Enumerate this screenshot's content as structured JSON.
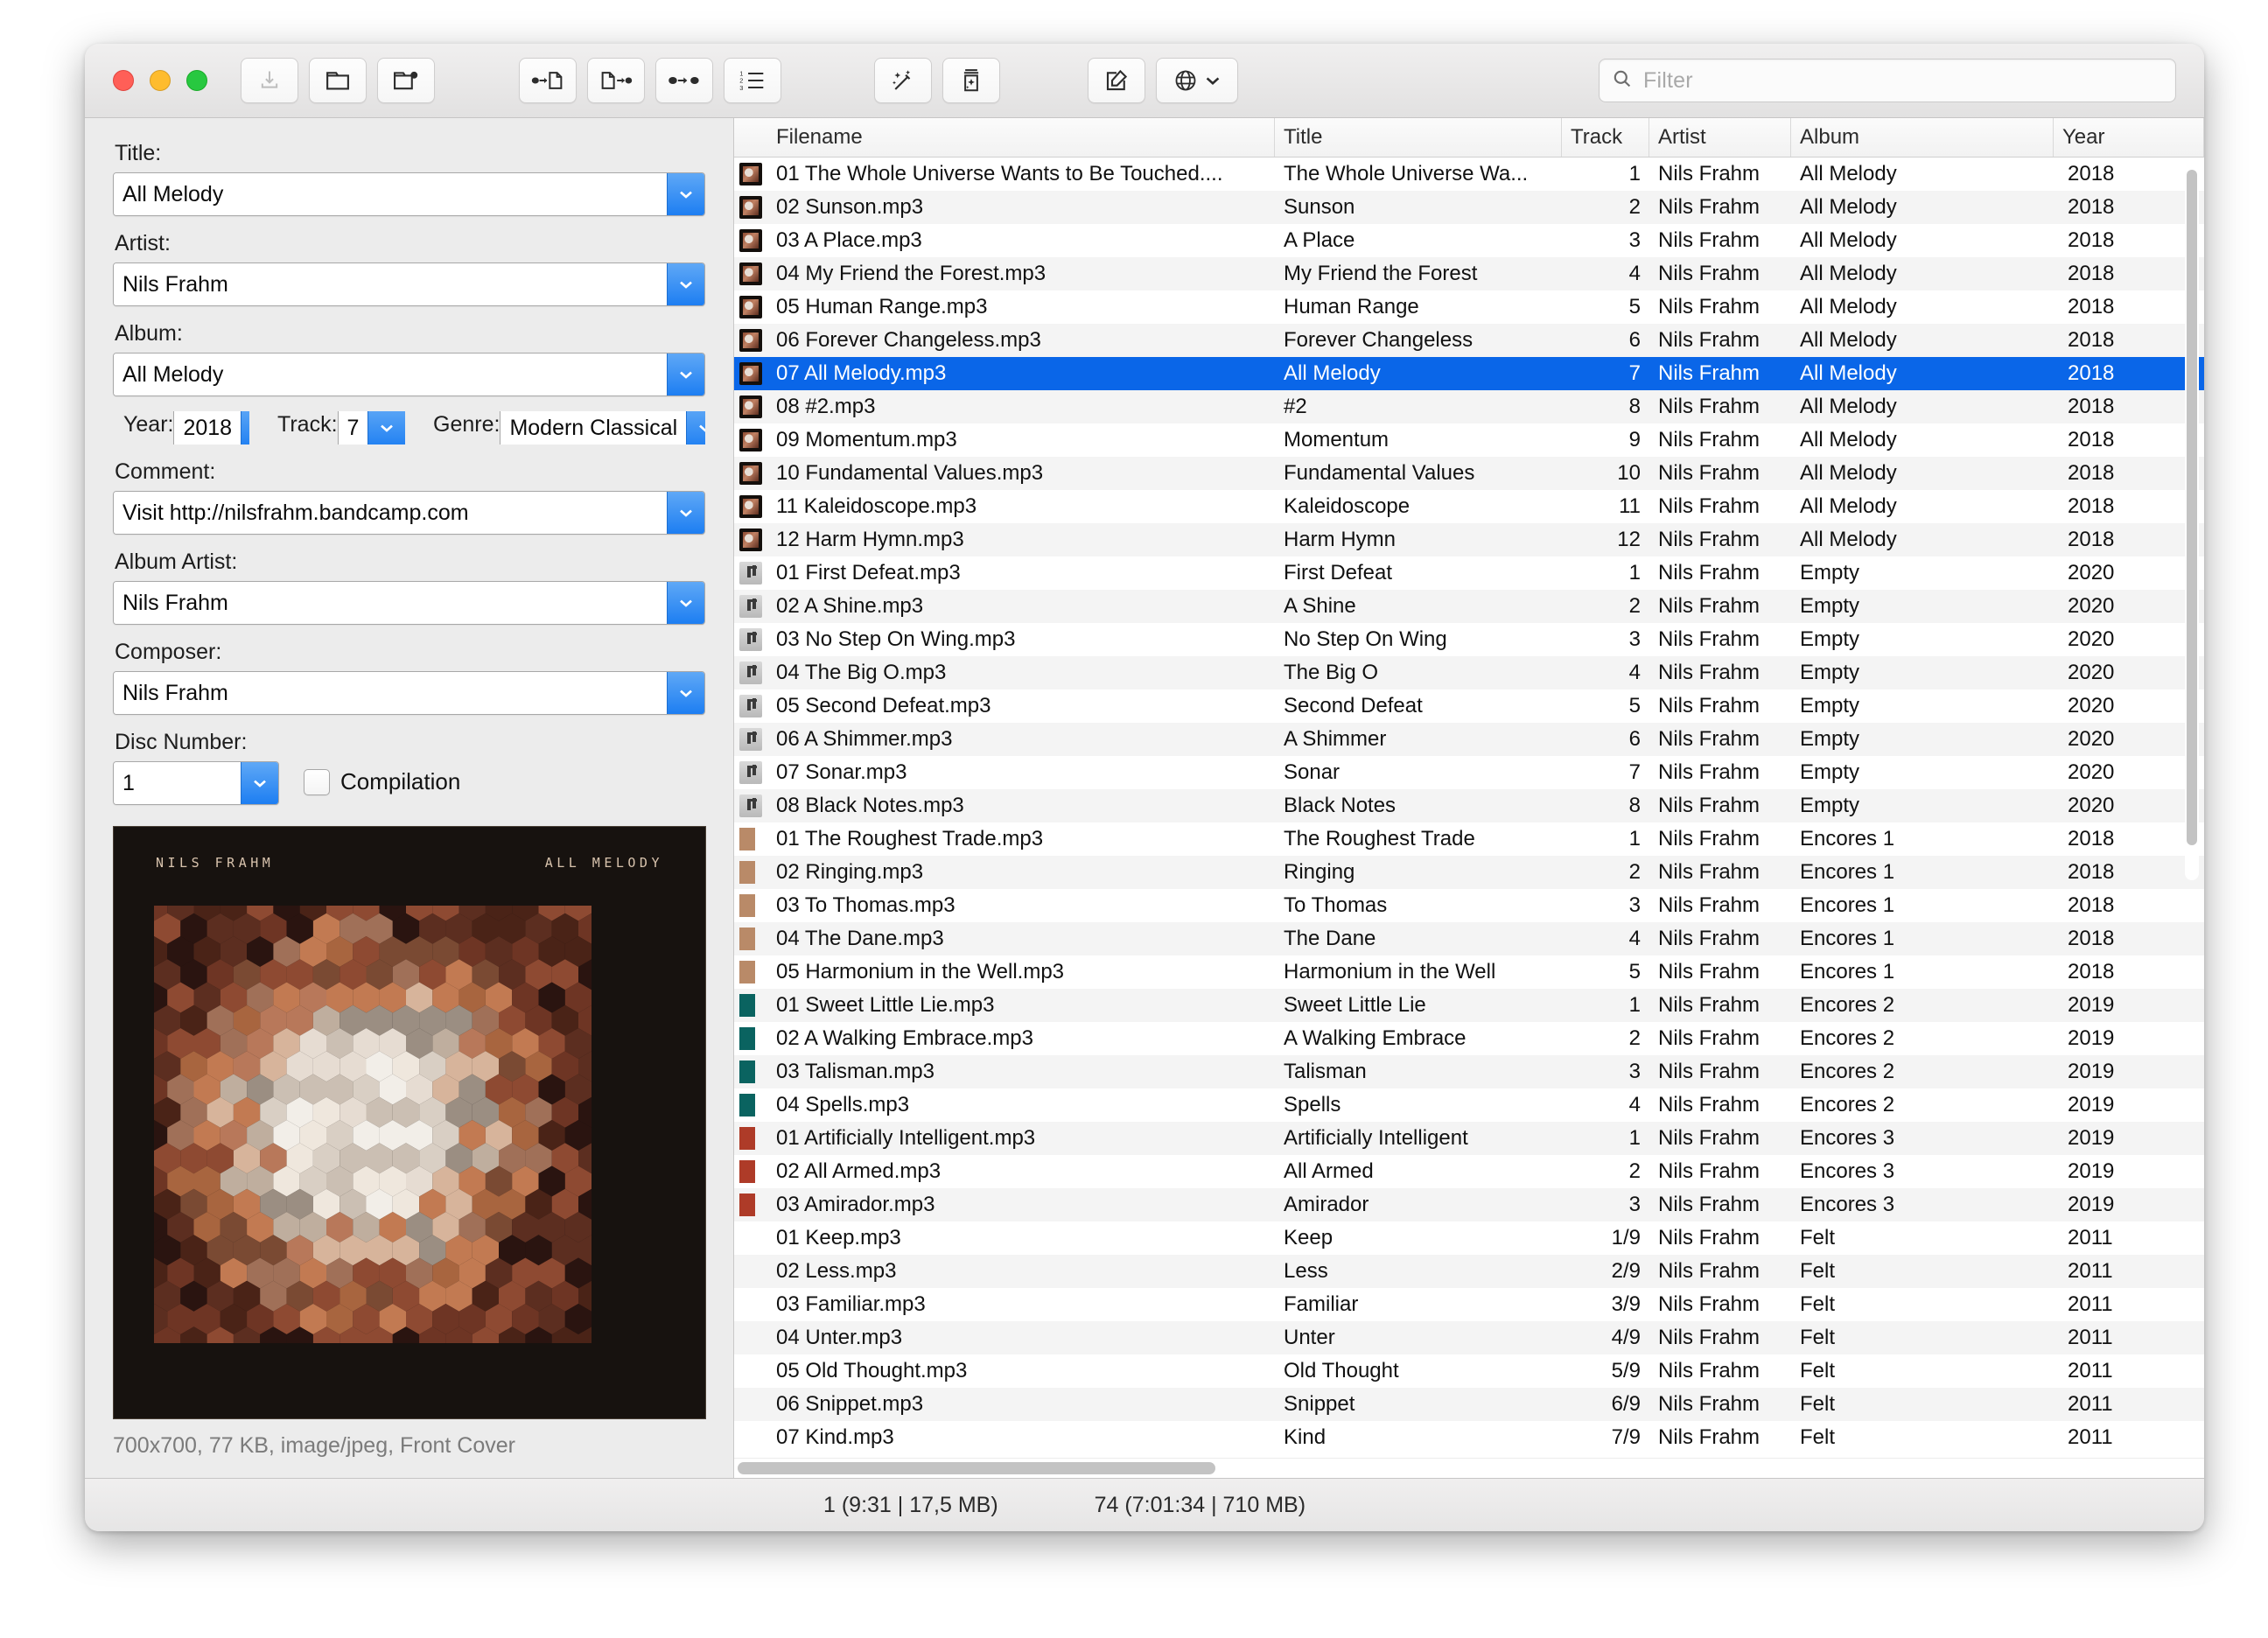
{
  "toolbar": {
    "buttons": [
      {
        "name": "save-button",
        "icon": "save-icon",
        "disabled": true
      },
      {
        "name": "open-folder-button",
        "icon": "folder-icon",
        "disabled": false
      },
      {
        "name": "add-folder-button",
        "icon": "folder-add-icon",
        "disabled": false
      },
      {
        "name": "tag-to-file-button",
        "icon": "tag-to-file-icon",
        "disabled": false
      },
      {
        "name": "file-to-tag-button",
        "icon": "file-to-tag-icon",
        "disabled": false
      },
      {
        "name": "tag-to-tag-button",
        "icon": "tag-to-tag-icon",
        "disabled": false
      },
      {
        "name": "numbering-button",
        "icon": "numbered-list-icon",
        "disabled": false
      },
      {
        "name": "auto-tag-button",
        "icon": "magic-wand-icon",
        "disabled": false
      },
      {
        "name": "tag-source-button",
        "icon": "jar-sparkle-icon",
        "disabled": false
      },
      {
        "name": "edit-button",
        "icon": "pencil-square-icon",
        "disabled": false
      },
      {
        "name": "web-sources-button",
        "icon": "globe-icon",
        "disabled": false
      }
    ]
  },
  "search": {
    "icon": "search-icon",
    "placeholder": "Filter",
    "value": ""
  },
  "editor": {
    "labels": {
      "title": "Title:",
      "artist": "Artist:",
      "album": "Album:",
      "year": "Year:",
      "track": "Track:",
      "genre": "Genre:",
      "comment": "Comment:",
      "album_artist": "Album Artist:",
      "composer": "Composer:",
      "disc_number": "Disc Number:",
      "compilation": "Compilation"
    },
    "values": {
      "title": "All Melody",
      "artist": "Nils Frahm",
      "album": "All Melody",
      "year": "2018",
      "track": "7",
      "genre": "Modern Classical",
      "comment": "Visit http://nilsfrahm.bandcamp.com",
      "album_artist": "Nils Frahm",
      "composer": "Nils Frahm",
      "disc_number": "1",
      "compilation_checked": false
    },
    "artwork": {
      "credit_left": "NILS FRAHM",
      "credit_right": "ALL MELODY",
      "caption": "700x700, 77 KB, image/jpeg, Front Cover"
    }
  },
  "table": {
    "columns": [
      "Filename",
      "Title",
      "Track",
      "Artist",
      "Album",
      "Year"
    ],
    "rows": [
      {
        "art": "allmelody",
        "filename": "01 The Whole Universe Wants to Be Touched....",
        "title": "The Whole Universe Wa...",
        "track": "1",
        "artist": "Nils Frahm",
        "album": "All Melody",
        "year": "2018",
        "selected": false
      },
      {
        "art": "allmelody",
        "filename": "02 Sunson.mp3",
        "title": "Sunson",
        "track": "2",
        "artist": "Nils Frahm",
        "album": "All Melody",
        "year": "2018",
        "selected": false
      },
      {
        "art": "allmelody",
        "filename": "03 A Place.mp3",
        "title": "A Place",
        "track": "3",
        "artist": "Nils Frahm",
        "album": "All Melody",
        "year": "2018",
        "selected": false
      },
      {
        "art": "allmelody",
        "filename": "04 My Friend the Forest.mp3",
        "title": "My Friend the Forest",
        "track": "4",
        "artist": "Nils Frahm",
        "album": "All Melody",
        "year": "2018",
        "selected": false
      },
      {
        "art": "allmelody",
        "filename": "05 Human Range.mp3",
        "title": "Human Range",
        "track": "5",
        "artist": "Nils Frahm",
        "album": "All Melody",
        "year": "2018",
        "selected": false
      },
      {
        "art": "allmelody",
        "filename": "06 Forever Changeless.mp3",
        "title": "Forever Changeless",
        "track": "6",
        "artist": "Nils Frahm",
        "album": "All Melody",
        "year": "2018",
        "selected": false
      },
      {
        "art": "allmelody",
        "filename": "07 All Melody.mp3",
        "title": "All Melody",
        "track": "7",
        "artist": "Nils Frahm",
        "album": "All Melody",
        "year": "2018",
        "selected": true
      },
      {
        "art": "allmelody",
        "filename": "08 #2.mp3",
        "title": "#2",
        "track": "8",
        "artist": "Nils Frahm",
        "album": "All Melody",
        "year": "2018",
        "selected": false
      },
      {
        "art": "allmelody",
        "filename": "09 Momentum.mp3",
        "title": "Momentum",
        "track": "9",
        "artist": "Nils Frahm",
        "album": "All Melody",
        "year": "2018",
        "selected": false
      },
      {
        "art": "allmelody",
        "filename": "10 Fundamental Values.mp3",
        "title": "Fundamental Values",
        "track": "10",
        "artist": "Nils Frahm",
        "album": "All Melody",
        "year": "2018",
        "selected": false
      },
      {
        "art": "allmelody",
        "filename": "11 Kaleidoscope.mp3",
        "title": "Kaleidoscope",
        "track": "11",
        "artist": "Nils Frahm",
        "album": "All Melody",
        "year": "2018",
        "selected": false
      },
      {
        "art": "allmelody",
        "filename": "12 Harm Hymn.mp3",
        "title": "Harm Hymn",
        "track": "12",
        "artist": "Nils Frahm",
        "album": "All Melody",
        "year": "2018",
        "selected": false
      },
      {
        "art": "empty",
        "filename": "01 First Defeat.mp3",
        "title": "First Defeat",
        "track": "1",
        "artist": "Nils Frahm",
        "album": "Empty",
        "year": "2020",
        "selected": false
      },
      {
        "art": "empty",
        "filename": "02 A Shine.mp3",
        "title": "A Shine",
        "track": "2",
        "artist": "Nils Frahm",
        "album": "Empty",
        "year": "2020",
        "selected": false
      },
      {
        "art": "empty",
        "filename": "03 No Step On Wing.mp3",
        "title": "No Step On Wing",
        "track": "3",
        "artist": "Nils Frahm",
        "album": "Empty",
        "year": "2020",
        "selected": false
      },
      {
        "art": "empty",
        "filename": "04 The Big O.mp3",
        "title": "The Big O",
        "track": "4",
        "artist": "Nils Frahm",
        "album": "Empty",
        "year": "2020",
        "selected": false
      },
      {
        "art": "empty",
        "filename": "05 Second Defeat.mp3",
        "title": "Second Defeat",
        "track": "5",
        "artist": "Nils Frahm",
        "album": "Empty",
        "year": "2020",
        "selected": false
      },
      {
        "art": "empty",
        "filename": "06 A Shimmer.mp3",
        "title": "A Shimmer",
        "track": "6",
        "artist": "Nils Frahm",
        "album": "Empty",
        "year": "2020",
        "selected": false
      },
      {
        "art": "empty",
        "filename": "07 Sonar.mp3",
        "title": "Sonar",
        "track": "7",
        "artist": "Nils Frahm",
        "album": "Empty",
        "year": "2020",
        "selected": false
      },
      {
        "art": "empty",
        "filename": "08 Black Notes.mp3",
        "title": "Black Notes",
        "track": "8",
        "artist": "Nils Frahm",
        "album": "Empty",
        "year": "2020",
        "selected": false
      },
      {
        "art": "encores1",
        "filename": "01 The Roughest Trade.mp3",
        "title": "The Roughest Trade",
        "track": "1",
        "artist": "Nils Frahm",
        "album": "Encores 1",
        "year": "2018",
        "selected": false
      },
      {
        "art": "encores1",
        "filename": "02 Ringing.mp3",
        "title": "Ringing",
        "track": "2",
        "artist": "Nils Frahm",
        "album": "Encores 1",
        "year": "2018",
        "selected": false
      },
      {
        "art": "encores1",
        "filename": "03 To Thomas.mp3",
        "title": "To Thomas",
        "track": "3",
        "artist": "Nils Frahm",
        "album": "Encores 1",
        "year": "2018",
        "selected": false
      },
      {
        "art": "encores1",
        "filename": "04 The Dane.mp3",
        "title": "The Dane",
        "track": "4",
        "artist": "Nils Frahm",
        "album": "Encores 1",
        "year": "2018",
        "selected": false
      },
      {
        "art": "encores1",
        "filename": "05 Harmonium in the Well.mp3",
        "title": "Harmonium in the Well",
        "track": "5",
        "artist": "Nils Frahm",
        "album": "Encores 1",
        "year": "2018",
        "selected": false
      },
      {
        "art": "encores2",
        "filename": "01 Sweet Little Lie.mp3",
        "title": "Sweet Little Lie",
        "track": "1",
        "artist": "Nils Frahm",
        "album": "Encores 2",
        "year": "2019",
        "selected": false
      },
      {
        "art": "encores2",
        "filename": "02 A Walking Embrace.mp3",
        "title": "A Walking Embrace",
        "track": "2",
        "artist": "Nils Frahm",
        "album": "Encores 2",
        "year": "2019",
        "selected": false
      },
      {
        "art": "encores2",
        "filename": "03 Talisman.mp3",
        "title": "Talisman",
        "track": "3",
        "artist": "Nils Frahm",
        "album": "Encores 2",
        "year": "2019",
        "selected": false
      },
      {
        "art": "encores2",
        "filename": "04 Spells.mp3",
        "title": "Spells",
        "track": "4",
        "artist": "Nils Frahm",
        "album": "Encores 2",
        "year": "2019",
        "selected": false
      },
      {
        "art": "encores3",
        "filename": "01 Artificially Intelligent.mp3",
        "title": "Artificially Intelligent",
        "track": "1",
        "artist": "Nils Frahm",
        "album": "Encores 3",
        "year": "2019",
        "selected": false
      },
      {
        "art": "encores3",
        "filename": "02 All Armed.mp3",
        "title": "All Armed",
        "track": "2",
        "artist": "Nils Frahm",
        "album": "Encores 3",
        "year": "2019",
        "selected": false
      },
      {
        "art": "encores3",
        "filename": "03 Amirador.mp3",
        "title": "Amirador",
        "track": "3",
        "artist": "Nils Frahm",
        "album": "Encores 3",
        "year": "2019",
        "selected": false
      },
      {
        "art": "none",
        "filename": "01 Keep.mp3",
        "title": "Keep",
        "track": "1/9",
        "artist": "Nils Frahm",
        "album": "Felt",
        "year": "2011",
        "selected": false
      },
      {
        "art": "none",
        "filename": "02 Less.mp3",
        "title": "Less",
        "track": "2/9",
        "artist": "Nils Frahm",
        "album": "Felt",
        "year": "2011",
        "selected": false
      },
      {
        "art": "none",
        "filename": "03 Familiar.mp3",
        "title": "Familiar",
        "track": "3/9",
        "artist": "Nils Frahm",
        "album": "Felt",
        "year": "2011",
        "selected": false
      },
      {
        "art": "none",
        "filename": "04 Unter.mp3",
        "title": "Unter",
        "track": "4/9",
        "artist": "Nils Frahm",
        "album": "Felt",
        "year": "2011",
        "selected": false
      },
      {
        "art": "none",
        "filename": "05 Old Thought.mp3",
        "title": "Old Thought",
        "track": "5/9",
        "artist": "Nils Frahm",
        "album": "Felt",
        "year": "2011",
        "selected": false
      },
      {
        "art": "none",
        "filename": "06 Snippet.mp3",
        "title": "Snippet",
        "track": "6/9",
        "artist": "Nils Frahm",
        "album": "Felt",
        "year": "2011",
        "selected": false
      },
      {
        "art": "none",
        "filename": "07 Kind.mp3",
        "title": "Kind",
        "track": "7/9",
        "artist": "Nils Frahm",
        "album": "Felt",
        "year": "2011",
        "selected": false
      }
    ]
  },
  "status": {
    "selection": "1 (9:31 | 17,5 MB)",
    "total": "74 (7:01:34 | 710 MB)"
  },
  "colors": {
    "selection_blue": "#0a66e8",
    "combo_arrow_blue": "#1d7ef2",
    "encores1": "#b98a68",
    "encores2": "#0a6360",
    "encores3": "#ae3b28"
  }
}
